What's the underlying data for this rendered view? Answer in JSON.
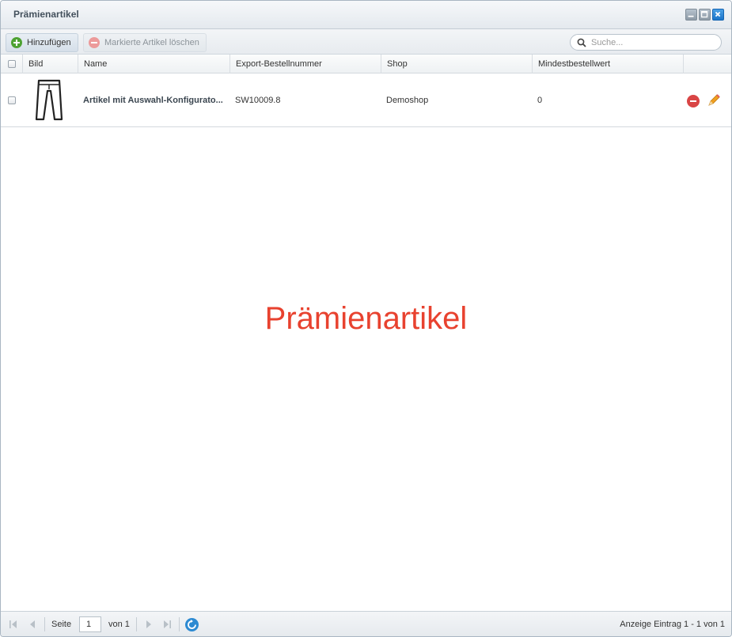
{
  "window": {
    "title": "Prämienartikel"
  },
  "toolbar": {
    "add_label": "Hinzufügen",
    "delete_label": "Markierte Artikel löschen",
    "search_placeholder": "Suche..."
  },
  "grid": {
    "columns": [
      "Bild",
      "Name",
      "Export-Bestellnummer",
      "Shop",
      "Mindestbestellwert"
    ],
    "rows": [
      {
        "image_icon": "trousers-icon",
        "name": "Artikel mit Auswahl-Konfigurato...",
        "order_number": "SW10009.8",
        "shop": "Demoshop",
        "min_order_value": "0"
      }
    ]
  },
  "watermark": "Prämienartikel",
  "paging": {
    "page_label": "Seite",
    "page_value": "1",
    "of_label": "von 1",
    "info": "Anzeige Eintrag 1 - 1 von 1"
  },
  "colors": {
    "add_icon": "#4da232",
    "delete_icon": "#d94545",
    "edit_icon": "#f0a020",
    "watermark": "#e8422f",
    "refresh": "#2d8ad2"
  }
}
